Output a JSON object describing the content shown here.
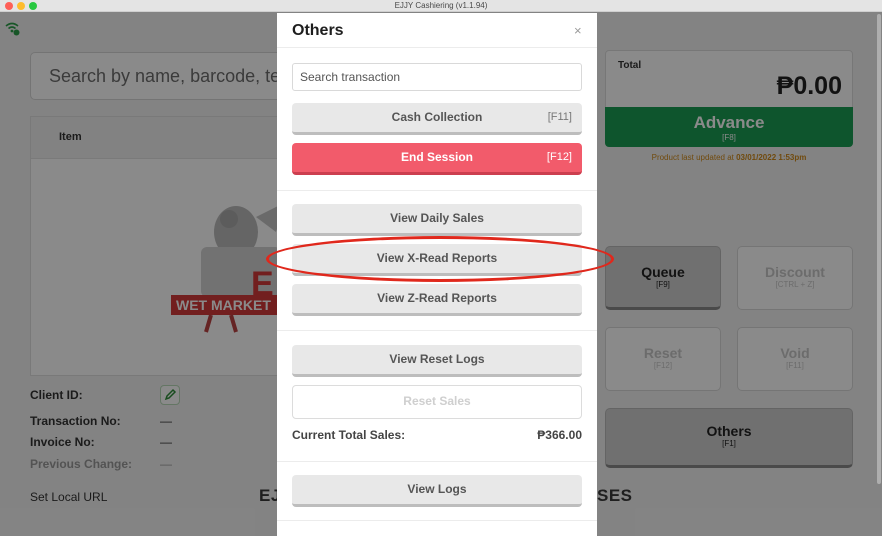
{
  "window": {
    "title": "EJJY Cashiering (v1.1.94)"
  },
  "main": {
    "search_placeholder": "Search by name, barcode, te",
    "item_header": "Item",
    "logo_text": "WET MARKET",
    "logo_letter": "E",
    "client_id_label": "Client ID:",
    "transaction_no_label": "Transaction No:",
    "transaction_no_value": "—",
    "invoice_no_label": "Invoice No:",
    "invoice_no_value": "—",
    "previous_change_label": "Previous Change:",
    "previous_change_value": "—",
    "set_local_url": "Set Local URL",
    "bottom_left_text": "EJ",
    "bottom_right_text": "SES"
  },
  "right": {
    "total_label": "Total",
    "total_value": "₱0.00",
    "advance_label": "Advance",
    "advance_key": "[F8]",
    "updated_prefix": "Product last updated at ",
    "updated_at": "03/01/2022 1:53pm",
    "queue_label": "Queue",
    "queue_key": "[F9]",
    "discount_label": "Discount",
    "discount_key": "[CTRL + Z]",
    "reset_label": "Reset",
    "reset_key": "[F12]",
    "void_label": "Void",
    "void_key": "[F11]",
    "others_label": "Others",
    "others_key": "[F1]"
  },
  "modal": {
    "title": "Others",
    "close": "×",
    "search_placeholder": "Search transaction",
    "cash_collection": "Cash Collection",
    "cash_collection_key": "[F11]",
    "end_session": "End Session",
    "end_session_key": "[F12]",
    "view_daily_sales": "View Daily Sales",
    "view_xread": "View X-Read Reports",
    "view_zread": "View Z-Read Reports",
    "view_reset_logs": "View Reset Logs",
    "reset_sales": "Reset Sales",
    "current_total_sales_label": "Current Total Sales:",
    "current_total_sales_value": "₱366.00",
    "view_logs": "View Logs"
  },
  "colors": {
    "advance_green": "#1b9e54",
    "end_session_red": "#f25b6b",
    "annotation_red": "#e0281c",
    "note_orange": "#cf8a1a"
  }
}
